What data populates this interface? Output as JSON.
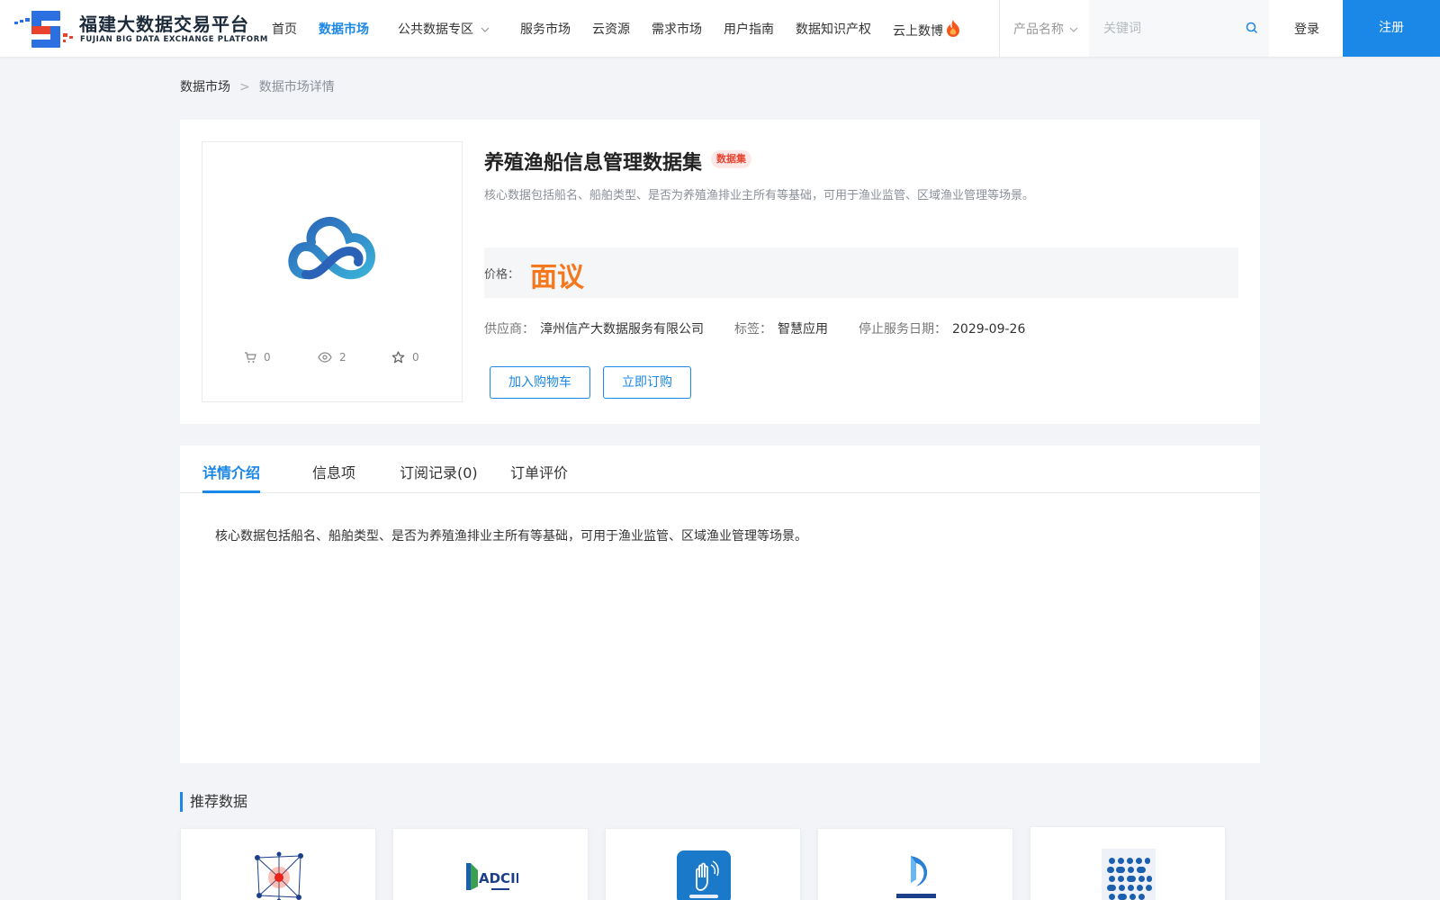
{
  "header": {
    "logo_cn": "福建大数据交易平台",
    "logo_en": "FUJIAN BIG DATA EXCHANGE  PLATFORM",
    "nav": [
      {
        "label": "首页"
      },
      {
        "label": "数据市场",
        "active": true
      },
      {
        "label": "公共数据专区"
      },
      {
        "label": "服务市场"
      },
      {
        "label": "云资源"
      },
      {
        "label": "需求市场"
      },
      {
        "label": "用户指南"
      },
      {
        "label": "数据知识产权"
      },
      {
        "label": "云上数博"
      }
    ],
    "search_select": "产品名称",
    "search_placeholder": "关键词",
    "login": "登录",
    "register": "注册",
    "accent_color": "#1b87e6"
  },
  "breadcrumb": {
    "home": "数据市场",
    "separator": ">",
    "current": "数据市场详情"
  },
  "product": {
    "title": "养殖渔船信息管理数据集",
    "badge": "数据集",
    "description": "核心数据包括船名、船舶类型、是否为养殖渔排业主所有等基础，可用于渔业监管、区域渔业管理等场景。",
    "price_label": "价格：",
    "price_value": "面议",
    "price_color": "#f5781e",
    "stats": {
      "cart": "0",
      "views": "2",
      "favorites": "0"
    },
    "supplier_label": "供应商：",
    "supplier_value": "漳州信产大数据服务有限公司",
    "tag_label": "标签：",
    "tag_value": "智慧应用",
    "stop_date_label": "停止服务日期：",
    "stop_date_value": "2029-09-26",
    "add_cart_button": "加入购物车",
    "order_now_button": "立即订购"
  },
  "tabs": {
    "items": [
      {
        "label": "详情介绍",
        "active": true
      },
      {
        "label": "信息项"
      },
      {
        "label": "订阅记录(0)"
      },
      {
        "label": "订单评价"
      }
    ],
    "content": "核心数据包括船名、船舶类型、是否为养殖渔排业主所有等基础，可用于渔业监管、区域渔业管理等场景。"
  },
  "recommended": {
    "title": "推荐数据",
    "cards": [
      {
        "icon": "network-node-icon"
      },
      {
        "icon": "adcid-logo-icon"
      },
      {
        "icon": "hand-signal-app-icon"
      },
      {
        "icon": "d-letter-logo-icon"
      },
      {
        "icon": "dot-grid-logo-icon"
      }
    ]
  }
}
